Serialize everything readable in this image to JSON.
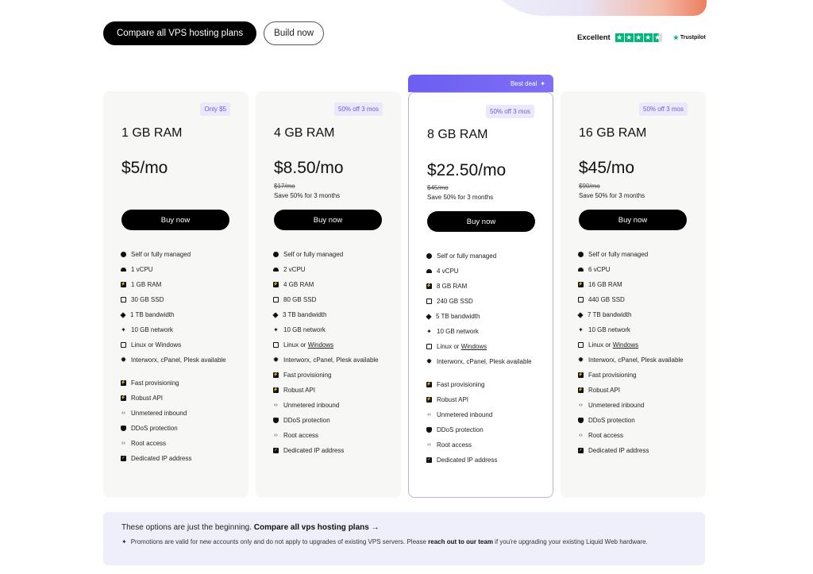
{
  "hero": {
    "fragment_text": "s, ,"
  },
  "cta": {
    "compare_label": "Compare all VPS hosting plans",
    "build_label": "Build now"
  },
  "trustpilot": {
    "label": "Excellent",
    "brand": "Trustpilot",
    "stars": 4.5
  },
  "best_deal": {
    "label": "Best deal"
  },
  "plans": [
    {
      "badge": "Only $5",
      "ram": "1 GB RAM",
      "price": "$5/mo",
      "strike": "",
      "save": "",
      "buy": "Buy now",
      "features": [
        [
          "user",
          "Self or fully managed"
        ],
        [
          "cloud",
          "1 vCPU"
        ],
        [
          "bolt",
          "1 GB RAM"
        ],
        [
          "box",
          "30 GB SSD"
        ],
        [
          "diamond",
          "1 TB bandwidth"
        ],
        [
          "spark",
          "10 GB network"
        ],
        [
          "box",
          "Linux or Windows"
        ],
        [
          "gear",
          "Interworx, cPanel, Plesk available"
        ],
        [
          "bolt",
          "Fast provisioning"
        ],
        [
          "bolt",
          "Robust API"
        ],
        [
          "code",
          "Unmetered inbound"
        ],
        [
          "shield",
          "DDoS protection"
        ],
        [
          "code",
          "Root access"
        ],
        [
          "check",
          "Dedicated IP address"
        ]
      ]
    },
    {
      "badge": "50% off 3 mos",
      "ram": "4 GB RAM",
      "price": "$8.50/mo",
      "strike": "$17/mo",
      "save": "Save 50% for 3 months",
      "buy": "Buy now",
      "features": [
        [
          "user",
          "Self or fully managed"
        ],
        [
          "cloud",
          "2 vCPU"
        ],
        [
          "bolt",
          "4 GB RAM"
        ],
        [
          "box",
          "80 GB SSD"
        ],
        [
          "diamond",
          "3 TB bandwidth"
        ],
        [
          "spark",
          "10 GB network"
        ],
        [
          "box",
          "Linux or |Windows"
        ],
        [
          "gear",
          "Interworx, cPanel, Plesk available"
        ],
        [
          "bolt",
          "Fast provisioning"
        ],
        [
          "bolt",
          "Robust API"
        ],
        [
          "code",
          "Unmetered inbound"
        ],
        [
          "shield",
          "DDoS protection"
        ],
        [
          "code",
          "Root access"
        ],
        [
          "check",
          "Dedicated IP address"
        ]
      ]
    },
    {
      "badge": "50% off 3 mos",
      "ram": "8 GB RAM",
      "price": "$22.50/mo",
      "strike": "$45/mo",
      "save": "Save 50% for 3 months",
      "buy": "Buy now",
      "features": [
        [
          "user",
          "Self or fully managed"
        ],
        [
          "cloud",
          "4 vCPU"
        ],
        [
          "bolt",
          "8 GB RAM"
        ],
        [
          "box",
          "240 GB SSD"
        ],
        [
          "diamond",
          "5 TB bandwidth"
        ],
        [
          "spark",
          "10 GB network"
        ],
        [
          "box",
          "Linux or |Windows"
        ],
        [
          "gear",
          "Interworx, cPanel, Plesk available"
        ],
        [
          "bolt",
          "Fast provisioning"
        ],
        [
          "bolt",
          "Robust API"
        ],
        [
          "code",
          "Unmetered inbound"
        ],
        [
          "shield",
          "DDoS protection"
        ],
        [
          "code",
          "Root access"
        ],
        [
          "check",
          "Dedicated IP address"
        ]
      ]
    },
    {
      "badge": "50% off 3 mos",
      "ram": "16 GB RAM",
      "price": "$45/mo",
      "strike": "$90/mo",
      "save": "Save 50% for 3 months",
      "buy": "Buy now",
      "features": [
        [
          "user",
          "Self or fully managed"
        ],
        [
          "cloud",
          "6 vCPU"
        ],
        [
          "bolt",
          "16 GB RAM"
        ],
        [
          "box",
          "440 GB SSD"
        ],
        [
          "diamond",
          "7 TB bandwidth"
        ],
        [
          "spark",
          "10 GB network"
        ],
        [
          "box",
          "Linux or |Windows"
        ],
        [
          "gear",
          "Interworx, cPanel, Plesk available"
        ],
        [
          "bolt",
          "Fast provisioning"
        ],
        [
          "bolt",
          "Robust API"
        ],
        [
          "code",
          "Unmetered inbound"
        ],
        [
          "shield",
          "DDoS protection"
        ],
        [
          "code",
          "Root access"
        ],
        [
          "check",
          "Dedicated IP address"
        ]
      ]
    }
  ],
  "info": {
    "intro": "These options are just the beginning. ",
    "compare_link": "Compare all vps hosting plans →",
    "note_pre": "Promotions are valid for new accounts only and do not apply to upgrades of existing VPS servers. Please ",
    "note_link": "reach out to our team",
    "note_post": " if you're upgrading your existing Liquid Web hardware."
  },
  "colors": {
    "accent": "#6c5ff0",
    "badge_bg": "#ebe8fb",
    "card_bg": "#f7f7f5",
    "info_bg": "#efeffb",
    "trustpilot": "#00b67a"
  }
}
